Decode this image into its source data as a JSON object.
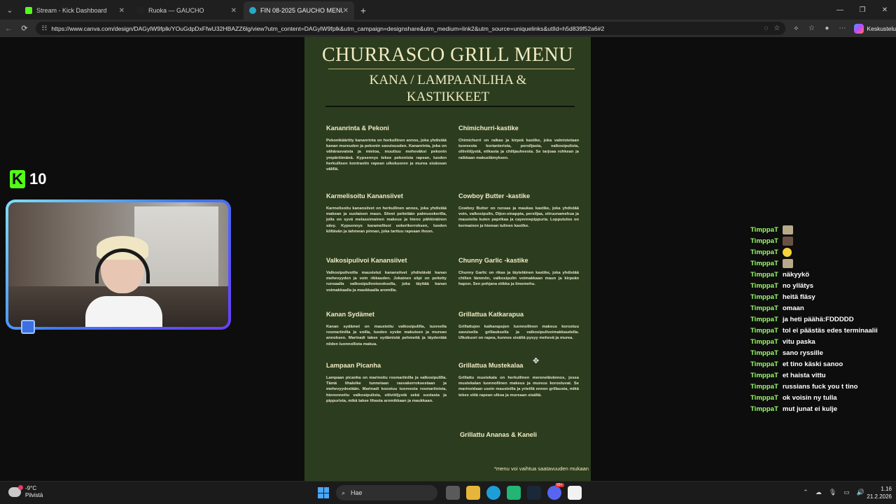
{
  "browser": {
    "tabs": [
      {
        "title": "Stream - Kick Dashboard",
        "active": false,
        "favicon_color": "#53fc18"
      },
      {
        "title": "Ruoka — GAUCHO",
        "active": false,
        "favicon_color": "#222222"
      },
      {
        "title": "FIN 08-2025 GAUCHO MENU",
        "active": true,
        "favicon_color": "#2aa7c9"
      }
    ],
    "url": "https://www.canva.com/design/DAGylW9fplk/YOuGdpDxFfwU32HBAZZ6lg/view?utm_content=DAGylW9fplk&utm_campaign=designshare&utm_medium=link2&utm_source=uniquelinks&utlId=h5d839f52a6#2",
    "copilot_label": "Keskustelu"
  },
  "menu": {
    "title": "CHURRASCO GRILL MENU",
    "subtitle_line1": "KANA / LAMPAANLIHA &",
    "subtitle_line2": "KASTIKKEET",
    "items": [
      {
        "title": "Kananrinta & Pekoni",
        "desc": "Pekonikääritty kananrinta on herkullinen annos, joka yhdistää kanan mureuden ja pekonin savuisuuden. Kananrinta, joka on vähärasvaista ja mietoa, muuttuu meheväksi pekonin ympäröimänä. Kypsennys tekee pekonista rapean, luoden herkullisen kontrastin rapean ulkokuoren ja murea sisäosan välillä."
      },
      {
        "title": "Chimichurri-kastike",
        "desc": "Chimichurri on raikas ja kirpeä kastike, joka valmistetaan tuoreesta korianterista, persiljasta, valkosipulista, oliiviöljystä, etikasta ja chilijauheesta. Se tarjoaa rohkean ja raikkaan makuelämyksen."
      },
      {
        "title": "Karmelisoitu Kanansiivet",
        "desc": "Karmelisoitu kanansiivet on herkullinen annos, joka yhdistää makean ja suolaisen maun. Siivet peitetään palmusokerilla, jolla on syvä melassimainen makeus ja hieno pähkinäinen sävy. Kypsennys karamellisoi sokerikerroksen, luoden kiiltävän ja tahmean pinnan, joka tarttuu rapeaan ihoon."
      },
      {
        "title": "Cowboy Butter -kastike",
        "desc": "Cowboy Butter on runsas ja maukas kastike, joka yhdistää voin, valkosipulin, Dijon-sinappia, persiljaa, sitruunamehua ja mausteita kuten paprikaa ja cayennepippuria. Lopputulos on kermainen ja hieman tulinen kastike."
      },
      {
        "title": "Valkosipulivoi Kanansiivet",
        "desc": "Valkosipulivoilla maustetut kanansiivet yhdistävät kanan mehevyyden ja voin rikkauden. Jokainen siipi on peitetty runsaalla valkosipulivoiseoksella, joka täyttää kanan voimakkaalla ja maukkaalla aromilla."
      },
      {
        "title": "Chunny Garlic -kastike",
        "desc": "Chunny Garlic on rikas ja täyteläinen kastike, joka yhdistää chilien lämmön, valkosipulin voimakkaan maun ja kirpeän hapon. Sen pohjana etikka ja limemehu."
      },
      {
        "title": "Kanan Sydämet",
        "desc": "Kanan sydämet on maustettu valkosipulilla, tuoreella rosmariinilla ja voilla, luoden syvän makuisen ja murean annoksen. Marinadi takee sydämistä pehmeitä ja täydentää niiden luonnollista makua."
      },
      {
        "title": "Grillattua Katkarapua",
        "desc": "Grillattujen katkarapujen luonnollinen makeus korostuu savuisella grillauksella ja valkosipulivoimakkaudella. Ulkokuori on rapea, kunnes sisältä pysyy mehevä ja murea."
      },
      {
        "title": "Lampaan Picanha",
        "desc": "Lampaan picanha on marinoitu rosmariinilla ja valkosipulilla. Tämä lihaleike tunnetaan rasvakerroksestaan ja mehevyydestään. Marinadi koostuu tuoreesta rosmariinista, hienonnettu valkosipulista, oliiviöljystä sekä suolasta ja pippurista, mikä takee lihasta aromikkaan ja maukkaan."
      },
      {
        "title": "Grillattua Mustekalaa",
        "desc": "Grillattu mustekala on herkullinen merenelävännos, jossa mustekalan luonnollinen makeus ja mureus korostuvat. Se marinoidaan usein mausteilla ja yrteillä ennen grillausta, mikä tekee siitä rapean ulkoa ja mureaan sisältä."
      },
      {
        "title": "Grillattu Ananas & Kaneli",
        "desc": ""
      }
    ],
    "footnote": "*menu voi vaihtua saatavuuden mukaan"
  },
  "stream": {
    "kick_logo_letter": "K",
    "viewer_count": "10"
  },
  "chat": [
    {
      "user": "TimppaT",
      "msg": "",
      "emote": "light"
    },
    {
      "user": "TimppaT",
      "msg": "",
      "emote": "dark"
    },
    {
      "user": "TimppaT",
      "msg": "",
      "emote": "yellow"
    },
    {
      "user": "TimppaT",
      "msg": "",
      "emote": "light"
    },
    {
      "user": "TimppaT",
      "msg": "näkyykö",
      "emote": ""
    },
    {
      "user": "TimppaT",
      "msg": "no yllätys",
      "emote": ""
    },
    {
      "user": "TimppaT",
      "msg": "heitä fläsy",
      "emote": ""
    },
    {
      "user": "TimppaT",
      "msg": "omaan",
      "emote": ""
    },
    {
      "user": "TimppaT",
      "msg": "ja heti päähä:FDDDDD",
      "emote": ""
    },
    {
      "user": "TimppaT",
      "msg": "tol ei päästäs edes terminaalii",
      "emote": ""
    },
    {
      "user": "TimppaT",
      "msg": "vitu paska",
      "emote": ""
    },
    {
      "user": "TimppaT",
      "msg": "sano ryssille",
      "emote": ""
    },
    {
      "user": "TimppaT",
      "msg": "et tino käski sanoo",
      "emote": ""
    },
    {
      "user": "TimppaT",
      "msg": "et haista vittu",
      "emote": ""
    },
    {
      "user": "TimppaT",
      "msg": "russians fuck you t tino",
      "emote": ""
    },
    {
      "user": "TimppaT",
      "msg": "ok voisin ny tulla",
      "emote": ""
    },
    {
      "user": "TimppaT",
      "msg": "mut junat ei kulje",
      "emote": ""
    }
  ],
  "taskbar": {
    "weather_temp": "-9°C",
    "weather_desc": "Pilvistä",
    "search_label": "Hae",
    "time": "1.16",
    "date": "21.2.2026",
    "badge": "99+"
  },
  "colors": {
    "menu_bg": "#2c3d1f",
    "menu_text": "#f0eac0",
    "kick_green": "#53fc18",
    "chat_user": "#9cff6a"
  }
}
